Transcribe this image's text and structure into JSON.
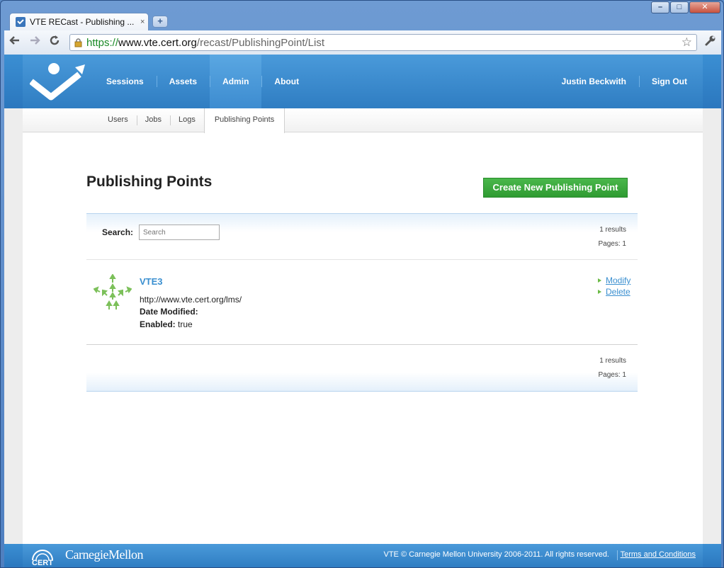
{
  "browser": {
    "tab_title": "VTE RECast - Publishing ...",
    "tab_close": "×",
    "new_tab": "+",
    "url_scheme": "https://",
    "url_host": "www.vte.cert.org",
    "url_path": "/recast/PublishingPoint/List",
    "window_minimize": "–",
    "window_maximize": "□",
    "window_close": "✕",
    "icons": [
      "back-icon",
      "forward-icon",
      "reload-icon",
      "lock-icon",
      "star-icon",
      "wrench-icon"
    ]
  },
  "header": {
    "nav": [
      {
        "label": "Sessions",
        "active": false
      },
      {
        "label": "Assets",
        "active": false
      },
      {
        "label": "Admin",
        "active": true
      },
      {
        "label": "About",
        "active": false
      }
    ],
    "user_name": "Justin Beckwith",
    "sign_out": "Sign Out"
  },
  "subnav": [
    {
      "label": "Users",
      "active": false
    },
    {
      "label": "Jobs",
      "active": false
    },
    {
      "label": "Logs",
      "active": false
    },
    {
      "label": "Publishing Points",
      "active": true
    }
  ],
  "main": {
    "title": "Publishing Points",
    "create_button": "Create New Publishing Point",
    "search_label": "Search:",
    "search_placeholder": "Search",
    "results_count": "1 results",
    "pages": "Pages: 1"
  },
  "items": [
    {
      "name": "VTE3",
      "url": "http://www.vte.cert.org/lms/",
      "date_modified_label": "Date Modified:",
      "date_modified": "",
      "enabled_label": "Enabled:",
      "enabled": "true",
      "actions": [
        "Modify",
        "Delete"
      ]
    }
  ],
  "footer": {
    "cert_logo": "CERT",
    "cmu_logo": "CarnegieMellon",
    "copyright": "VTE © Carnegie Mellon University 2006-2011. All rights reserved.",
    "terms": "Terms and Conditions"
  },
  "colors": {
    "header_blue": "#3a8ed2",
    "create_green": "#3aa83c",
    "link_blue": "#3a8fd0",
    "bullet_green": "#6bba45"
  }
}
